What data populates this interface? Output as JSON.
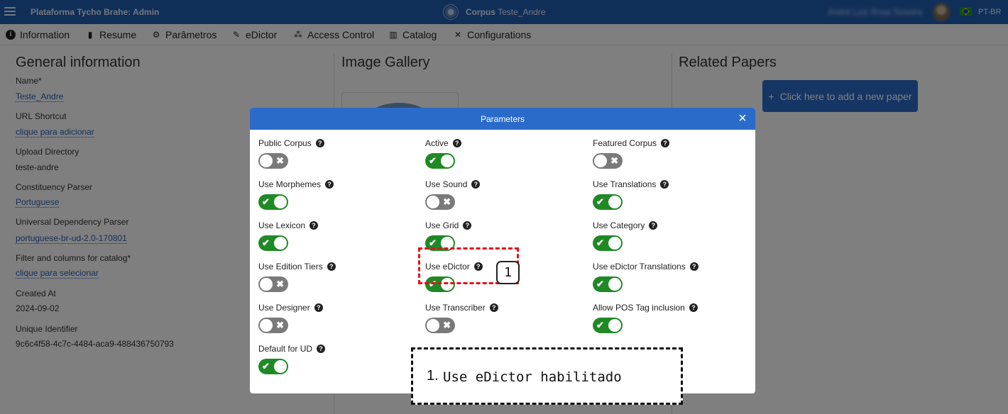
{
  "topbar": {
    "app_title": "Plataforma Tycho Brahe: Admin",
    "corpus_prefix": "Corpus",
    "corpus_name": "Teste_Andre",
    "user_name": "André Luiz Rosa Teixeira",
    "language": "PT-BR"
  },
  "nav": [
    {
      "label": "Information",
      "icon": "info-icon"
    },
    {
      "label": "Resume",
      "icon": "file-icon"
    },
    {
      "label": "Parâmetros",
      "icon": "cogs-icon"
    },
    {
      "label": "eDictor",
      "icon": "edit-icon"
    },
    {
      "label": "Access Control",
      "icon": "users-icon"
    },
    {
      "label": "Catalog",
      "icon": "book-icon"
    },
    {
      "label": "Configurations",
      "icon": "tools-icon"
    }
  ],
  "general": {
    "title": "General information",
    "fields": [
      {
        "label": "Name*",
        "value": "Teste_Andre",
        "link": true
      },
      {
        "label": "URL Shortcut",
        "value": "clique para adicionar",
        "link": true
      },
      {
        "label": "Upload Directory",
        "value": "teste-andre",
        "link": false
      },
      {
        "label": "Constituency Parser",
        "value": "Portuguese",
        "link": true
      },
      {
        "label": "Universal Dependency Parser",
        "value": "portuguese-br-ud-2.0-170801",
        "link": true
      },
      {
        "label": "Filter and columns for catalog*",
        "value": "clique para selecionar",
        "link": true
      },
      {
        "label": "Created At",
        "value": "2024-09-02",
        "link": false
      },
      {
        "label": "Unique Identifier",
        "value": "9c6c4f58-4c7c-4484-aca9-488436750793",
        "link": false
      }
    ]
  },
  "gallery": {
    "title": "Image Gallery"
  },
  "papers": {
    "title": "Related Papers",
    "add_button": "Click here to add a new paper"
  },
  "modal": {
    "title": "Parameters",
    "close": "×",
    "params": [
      {
        "label": "Public Corpus",
        "on": false
      },
      {
        "label": "Active",
        "on": true
      },
      {
        "label": "Featured Corpus",
        "on": false
      },
      {
        "label": "Use Morphemes",
        "on": true
      },
      {
        "label": "Use Sound",
        "on": false
      },
      {
        "label": "Use Translations",
        "on": true
      },
      {
        "label": "Use Lexicon",
        "on": true
      },
      {
        "label": "Use Grid",
        "on": true
      },
      {
        "label": "Use Category",
        "on": true
      },
      {
        "label": "Use Edition Tiers",
        "on": false
      },
      {
        "label": "Use eDictor",
        "on": true
      },
      {
        "label": "Use eDictor Translations",
        "on": true
      },
      {
        "label": "Use Designer",
        "on": false
      },
      {
        "label": "Use Transcriber",
        "on": false
      },
      {
        "label": "Allow POS Tag inclusion",
        "on": true
      },
      {
        "label": "Default for UD",
        "on": true
      }
    ]
  },
  "annotation": {
    "marker": "1",
    "note_number": "1.",
    "note_text": "Use eDictor habilitado"
  },
  "colors": {
    "header_blue": "#1f5fb3",
    "modal_blue": "#2a6bc9",
    "toggle_on": "#1f8a25",
    "toggle_off": "#7a7a7a",
    "highlight_red": "#e2121b"
  }
}
